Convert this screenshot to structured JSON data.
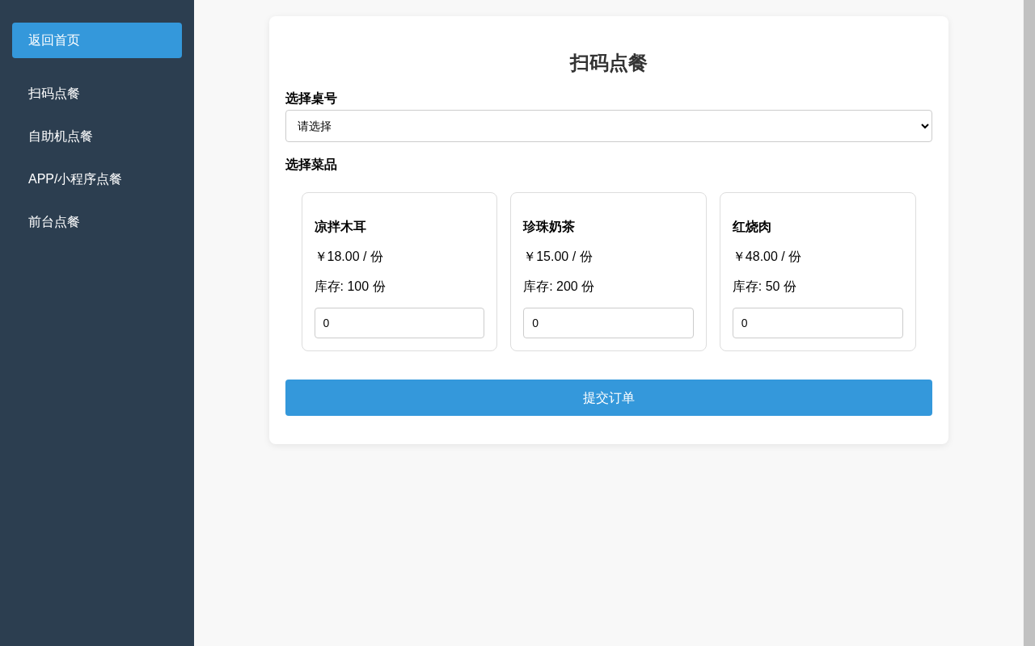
{
  "sidebar": {
    "back_button": "返回首页",
    "items": [
      {
        "label": "扫码点餐"
      },
      {
        "label": "自助机点餐"
      },
      {
        "label": "APP/小程序点餐"
      },
      {
        "label": "前台点餐"
      }
    ]
  },
  "page": {
    "title": "扫码点餐",
    "table_label": "选择桌号",
    "table_select": {
      "value": "请选择"
    },
    "dishes_label": "选择菜品",
    "dishes": [
      {
        "name": "凉拌木耳",
        "price": "￥18.00 / 份",
        "stock": "库存: 100 份",
        "quantity": "0"
      },
      {
        "name": "珍珠奶茶",
        "price": "￥15.00 / 份",
        "stock": "库存: 200 份",
        "quantity": "0"
      },
      {
        "name": "红烧肉",
        "price": "￥48.00 / 份",
        "stock": "库存: 50 份",
        "quantity": "0"
      }
    ],
    "submit_button": "提交订单"
  }
}
